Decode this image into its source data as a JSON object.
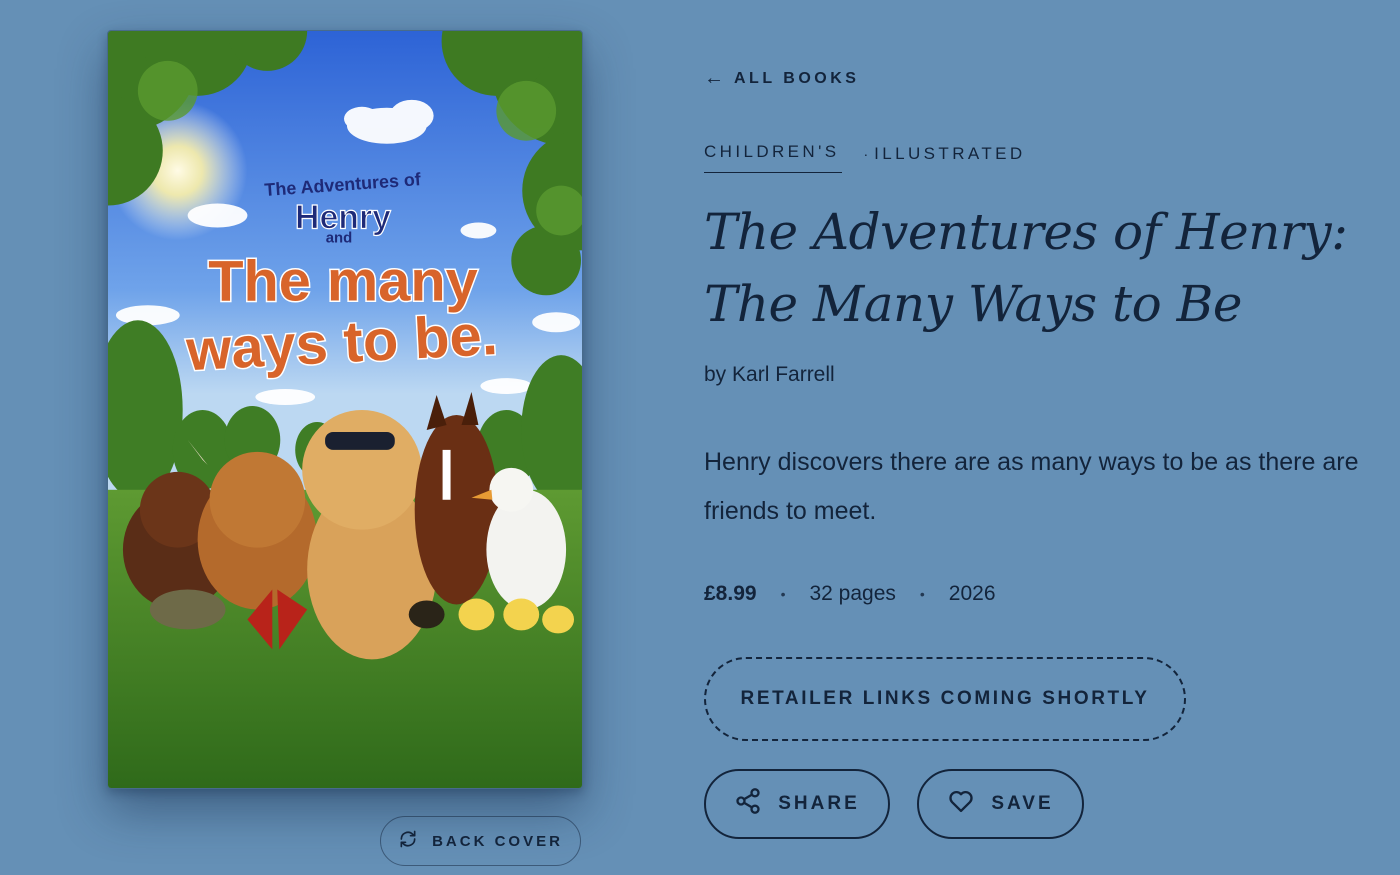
{
  "nav": {
    "back_arrow": "←",
    "back_label": "ALL BOOKS"
  },
  "book": {
    "genre_primary": "CHILDREN'S",
    "genre_separator": "·",
    "genre_secondary": "ILLUSTRATED",
    "title": "The Adventures of Henry: The Many Ways to Be",
    "author": "by Karl Farrell",
    "description": "Henry discovers there are as many ways to be as there are friends to meet.",
    "price": "£8.99",
    "pages": "32 pages",
    "year": "2026",
    "meta_separator": "•"
  },
  "cover": {
    "line1": "The Adventures of",
    "line2": "Henry",
    "line3": "and",
    "line4": "The many",
    "line5": "ways to be."
  },
  "actions": {
    "retailer_label": "RETAILER LINKS COMING SHORTLY",
    "share_label": "SHARE",
    "share_icon": "share-icon",
    "save_label": "SAVE",
    "save_icon": "heart-icon",
    "back_cover_label": "BACK COVER",
    "back_cover_icon": "flip-icon"
  },
  "colors": {
    "background": "#6590b6",
    "ink": "#13243b",
    "cover_title_orange": "#d8642a",
    "cover_title_navy": "#1e2a78"
  }
}
